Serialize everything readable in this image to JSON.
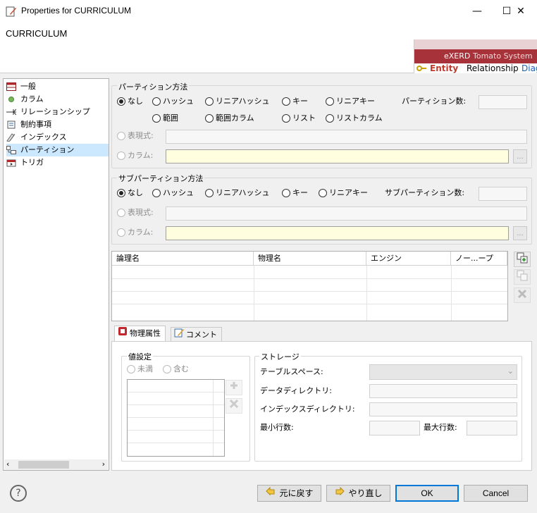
{
  "window": {
    "title": "Properties for CURRICULUM",
    "minimize": "—",
    "maximize": "☐",
    "close": "✕"
  },
  "header": {
    "entity_name": "CURRICULUM",
    "brand_main": "eXERD",
    "brand_sub": "Tomato System",
    "tabs": [
      "Entity",
      "Relationship",
      "Diag"
    ]
  },
  "tree": {
    "items": [
      "一般",
      "カラム",
      "リレーションシップ",
      "制約事項",
      "インデックス",
      "パーティション",
      "トリガ"
    ],
    "selected": 5
  },
  "partition": {
    "group_label": "パーティション方法",
    "options_row1": [
      "なし",
      "ハッシュ",
      "リニアハッシュ",
      "キー",
      "リニアキー"
    ],
    "options_row2": [
      "範囲",
      "範囲カラム",
      "リスト",
      "リストカラム"
    ],
    "count_label": "パーティション数:",
    "expr_label": "表現式:",
    "column_label": "カラム:",
    "browse": "..."
  },
  "subpartition": {
    "group_label": "サブパーティション方法",
    "options": [
      "なし",
      "ハッシュ",
      "リニアハッシュ",
      "キー",
      "リニアキー"
    ],
    "count_label": "サブパーティション数:",
    "expr_label": "表現式:",
    "column_label": "カラム:",
    "browse": "..."
  },
  "table": {
    "columns": [
      "論理名",
      "物理名",
      "エンジン",
      "ノー...ープ"
    ]
  },
  "bottom_tabs": [
    "物理属性",
    "コメント"
  ],
  "values": {
    "group_label": "値設定",
    "options": [
      "未満",
      "含む"
    ]
  },
  "storage": {
    "group_label": "ストレージ",
    "tablespace_label": "テーブルスペース:",
    "datadir_label": "データディレクトリ:",
    "indexdir_label": "インデックスディレクトリ:",
    "min_rows_label": "最小行数:",
    "max_rows_label": "最大行数:"
  },
  "buttons": {
    "help": "?",
    "revert": "元に戻す",
    "redo": "やり直し",
    "ok": "OK",
    "cancel": "Cancel"
  }
}
